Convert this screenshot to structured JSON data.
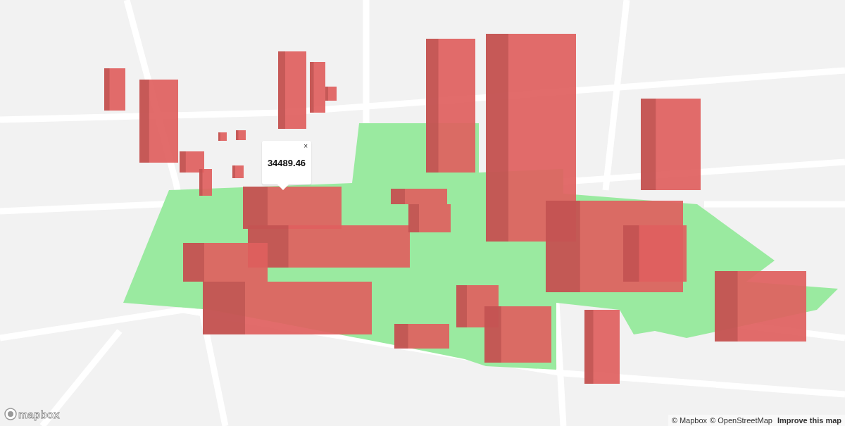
{
  "popup": {
    "value": "34489.46",
    "close": "×"
  },
  "logo": {
    "wordmark": "mapbox"
  },
  "attribution": [
    {
      "text": "© Mapbox",
      "kind": "link"
    },
    {
      "text": "© OpenStreetMap",
      "kind": "link"
    },
    {
      "text": "Improve this map",
      "kind": "bold"
    }
  ]
}
